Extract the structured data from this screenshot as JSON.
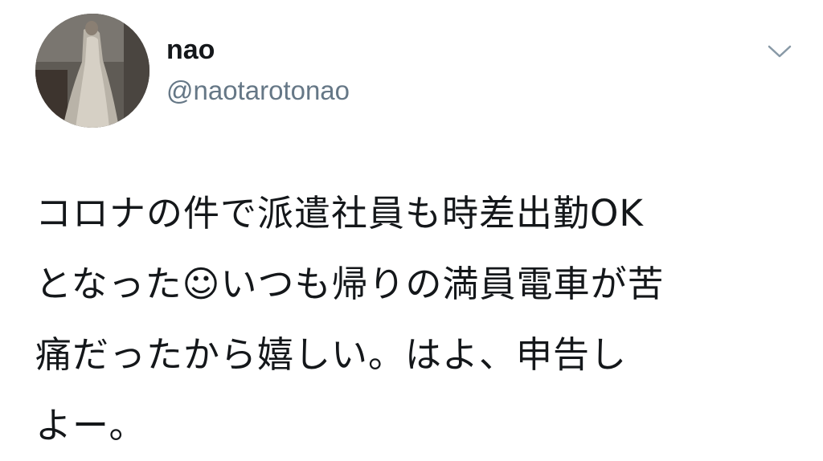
{
  "tweet": {
    "author": {
      "display_name": "nao",
      "handle": "@naotarotonao",
      "avatar": "avatar-photo"
    },
    "menu_icon": "chevron-down-icon",
    "text_lines": [
      "コロナの件で派遣社員も時差出勤OK",
      "となった☺いつも帰りの満員電車が苦",
      "痛だったから嬉しい。はよ、申告し",
      "よー。"
    ]
  }
}
